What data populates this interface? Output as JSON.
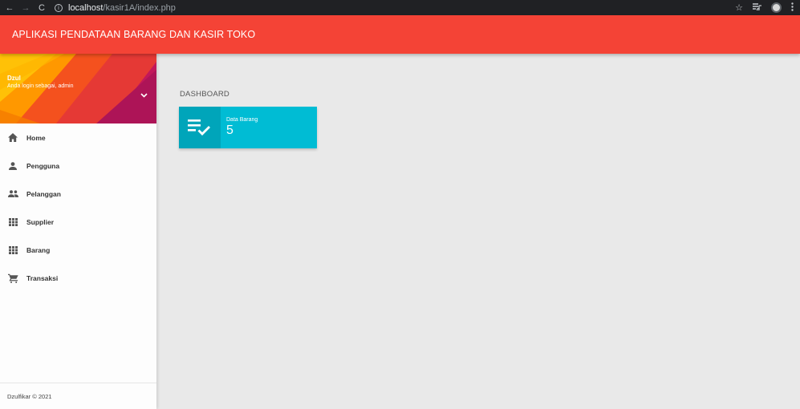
{
  "browser": {
    "back": "←",
    "forward": "→",
    "reload": "C",
    "info": "i",
    "url_host": "localhost",
    "url_path": "/kasir1A/index.php",
    "star": "☆"
  },
  "header": {
    "title": "APLIKASI PENDATAAN BARANG DAN KASIR TOKO"
  },
  "sidebar": {
    "user": {
      "name": "Dzul",
      "role": "Anda login sebagai, admin"
    },
    "items": [
      {
        "label": "Home",
        "icon": "home-icon"
      },
      {
        "label": "Pengguna",
        "icon": "person-icon"
      },
      {
        "label": "Pelanggan",
        "icon": "people-icon"
      },
      {
        "label": "Supplier",
        "icon": "grid-icon"
      },
      {
        "label": "Barang",
        "icon": "grid-icon"
      },
      {
        "label": "Transaksi",
        "icon": "cart-icon"
      }
    ],
    "footer": "Dzulfikar © 2021"
  },
  "main": {
    "heading": "DASHBOARD",
    "info_box": {
      "label": "Data Barang",
      "value": "5",
      "icon": "playlist-check-icon"
    }
  },
  "colors": {
    "header": "#f44336",
    "info_box": "#00bcd4"
  }
}
